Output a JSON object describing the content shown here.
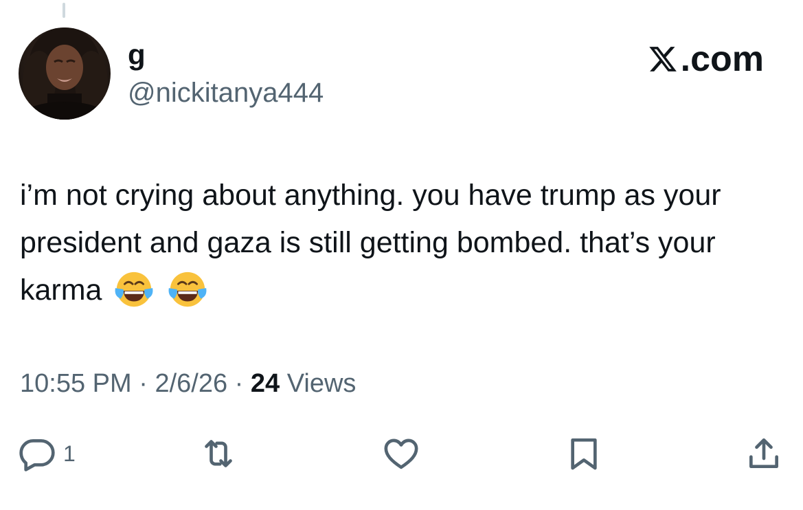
{
  "author": {
    "display_name": "g",
    "handle": "@nickitanya444"
  },
  "brand": {
    "label": ".com",
    "logo": "x-logo"
  },
  "tweet": {
    "text": "i’m not crying about anything. you have trump as your president and gaza is still getting bombed. that’s your karma",
    "emojis": [
      "face-with-tears-of-joy",
      "face-with-tears-of-joy"
    ]
  },
  "meta": {
    "time": "10:55 PM",
    "separator": "·",
    "date": "2/6/26",
    "views_count": "24",
    "views_label": "Views"
  },
  "actions": {
    "reply_icon": "reply-icon",
    "reply_count": "1",
    "retweet_icon": "retweet-icon",
    "like_icon": "heart-icon",
    "bookmark_icon": "bookmark-icon",
    "share_icon": "share-icon"
  },
  "colors": {
    "text_primary": "#0f1419",
    "text_secondary": "#536471",
    "icon": "#536471",
    "thread_line": "#cfd9de"
  }
}
